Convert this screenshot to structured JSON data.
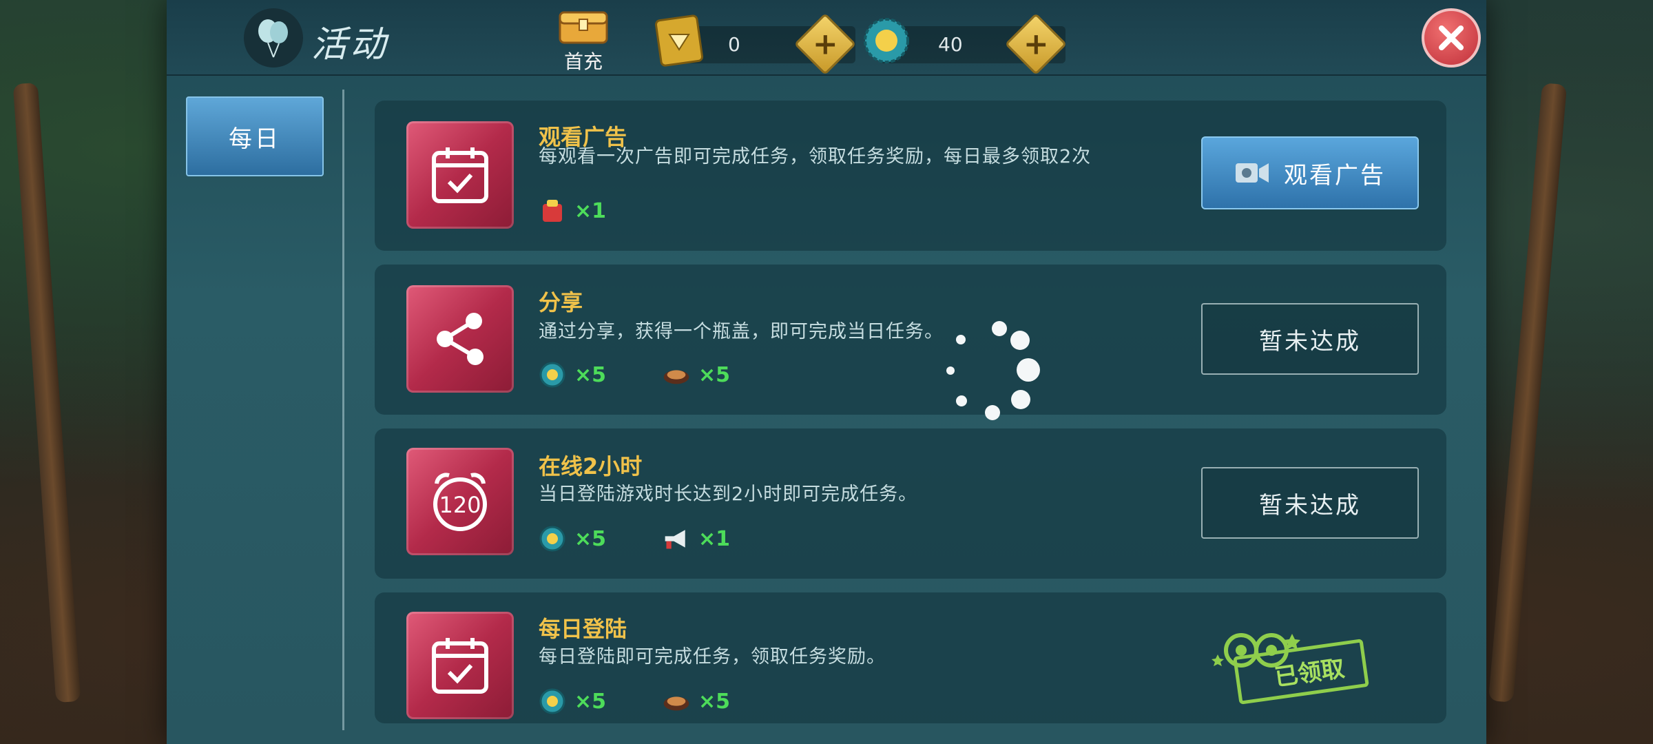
{
  "header": {
    "title": "活动",
    "first_charge_label": "首充",
    "diamonds": "0",
    "caps": "40"
  },
  "sidebar": {
    "tabs": [
      {
        "label": "每日"
      }
    ]
  },
  "tasks": [
    {
      "title": "观看广告",
      "desc": "每观看一次广告即可完成任务，领取任务奖励，每日最多领取2次",
      "rewards": [
        {
          "icon": "gift-bag-icon",
          "mult": "×1"
        }
      ],
      "button": "观看广告",
      "status": "watch"
    },
    {
      "title": "分享",
      "desc": "通过分享，获得一个瓶盖，即可完成当日任务。",
      "rewards": [
        {
          "icon": "bottle-cap-icon",
          "mult": "×5"
        },
        {
          "icon": "food-plate-icon",
          "mult": "×5"
        }
      ],
      "button": "暂未达成",
      "status": "pending"
    },
    {
      "title": "在线2小时",
      "desc": "当日登陆游戏时长达到2小时即可完成任务。",
      "icon_text": "120",
      "rewards": [
        {
          "icon": "bottle-cap-icon",
          "mult": "×5"
        },
        {
          "icon": "megaphone-icon",
          "mult": "×1"
        }
      ],
      "button": "暂未达成",
      "status": "pending"
    },
    {
      "title": "每日登陆",
      "desc": "每日登陆即可完成任务，领取任务奖励。",
      "rewards": [
        {
          "icon": "bottle-cap-icon",
          "mult": "×5"
        },
        {
          "icon": "food-plate-icon",
          "mult": "×5"
        }
      ],
      "button": "已领取",
      "status": "claimed"
    }
  ],
  "colors": {
    "title_gold": "#f0c24a",
    "reward_green": "#4ddc5a",
    "button_blue": "#3a84bc",
    "task_icon_red": "#b32a4a"
  }
}
